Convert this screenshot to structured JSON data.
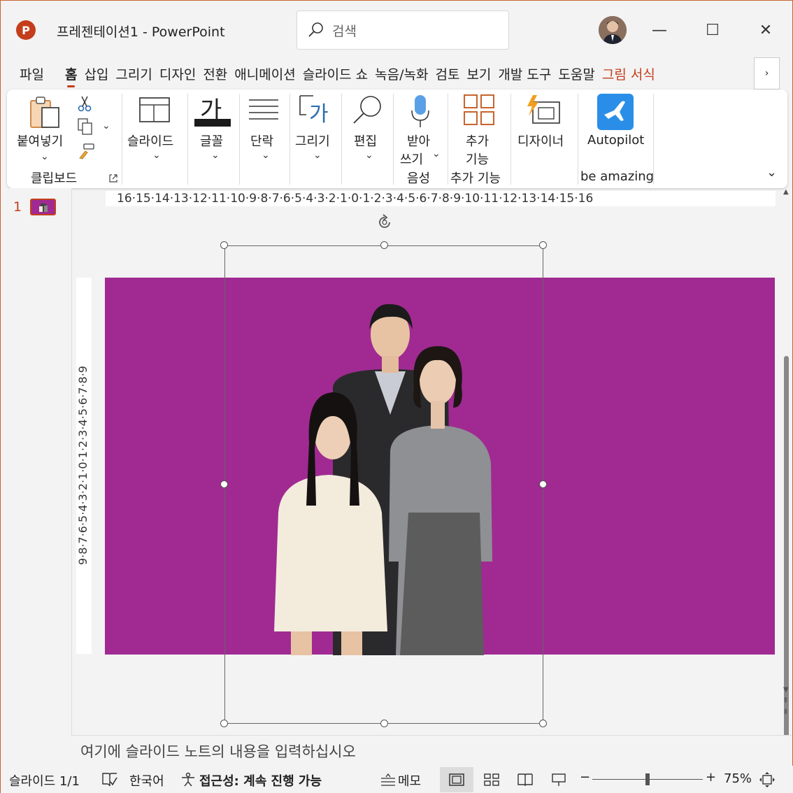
{
  "app": {
    "title": "프레젠테이션1  -  PowerPoint",
    "logo_letter": "P",
    "accent": "#c43e1c",
    "search_placeholder": "검색"
  },
  "window_controls": {
    "minimize": "—",
    "maximize": "☐",
    "close": "✕"
  },
  "tabs": [
    {
      "label": "파일",
      "selected": false
    },
    {
      "label": "홈",
      "selected": true
    },
    {
      "label": "삽입",
      "selected": false
    },
    {
      "label": "그리기",
      "selected": false
    },
    {
      "label": "디자인",
      "selected": false
    },
    {
      "label": "전환",
      "selected": false
    },
    {
      "label": "애니메이션",
      "selected": false
    },
    {
      "label": "슬라이드 쇼",
      "selected": false
    },
    {
      "label": "녹음/녹화",
      "selected": false
    },
    {
      "label": "검토",
      "selected": false
    },
    {
      "label": "보기",
      "selected": false
    },
    {
      "label": "개발 도구",
      "selected": false
    },
    {
      "label": "도움말",
      "selected": false
    },
    {
      "label": "그림 서식",
      "selected": false
    }
  ],
  "tab_more": "›",
  "ribbon": {
    "paste": "붙여넣기",
    "clipboard_group": "클립보드",
    "slide": "슬라이드",
    "font_glyph": "가",
    "font": "글꼴",
    "paragraph": "단락",
    "draw_glyph": "가",
    "draw": "그리기",
    "edit": "편집",
    "dictate_1": "받아",
    "dictate_2": "쓰기",
    "voice_group": "음성",
    "addins_1": "추가",
    "addins_2": "기능",
    "addins_group": "추가 기능",
    "designer": "디자이너",
    "autopilot": "Autopilot",
    "autopilot_group": "be amazing"
  },
  "ruler": {
    "horizontal": "16·15·14·13·12·11·10·9·8·7·6·5·4·3·2·1·0·1·2·3·4·5·6·7·8·9·10·11·12·13·14·15·16",
    "vertical": "9·8·7·6·5·4·3·2·1·0·1·2·3·4·5·6·7·8·9"
  },
  "slide_pane": {
    "slide_number": "1"
  },
  "slide": {
    "background": "#a02a92"
  },
  "notes_placeholder": "여기에 슬라이드 노트의 내용을 입력하십시오",
  "status": {
    "slide_count": "슬라이드 1/1",
    "language": "한국어",
    "accessibility": "접근성: 계속 진행 가능",
    "notes": "메모",
    "zoom_minus": "−",
    "zoom_plus": "+",
    "zoom": "75%",
    "zoom_level_fraction": 0.5
  }
}
